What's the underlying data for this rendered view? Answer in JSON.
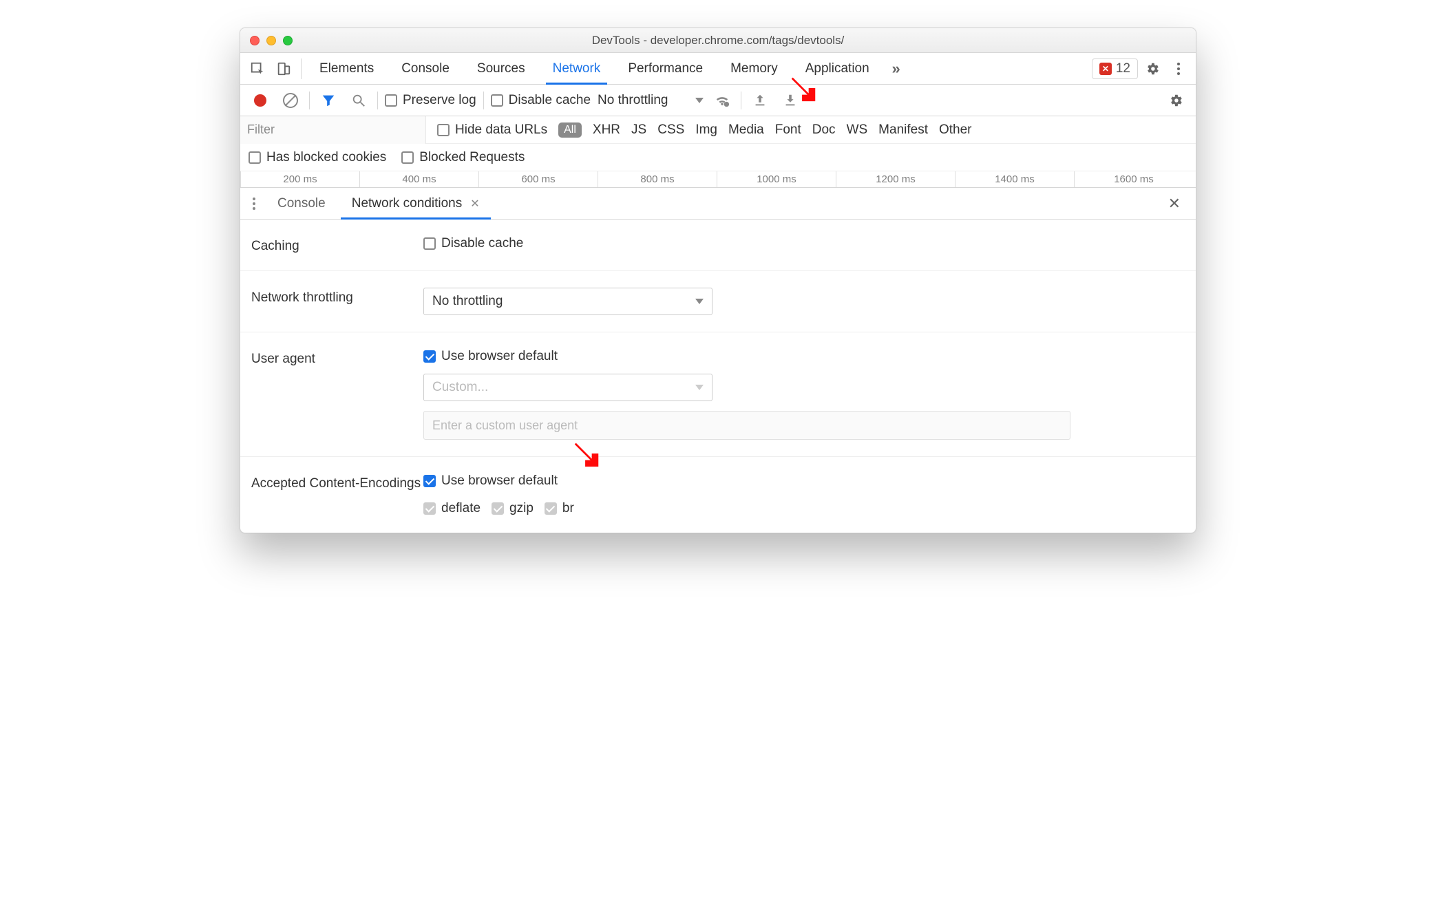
{
  "window": {
    "title": "DevTools - developer.chrome.com/tags/devtools/"
  },
  "tabs": {
    "items": [
      "Elements",
      "Console",
      "Sources",
      "Network",
      "Performance",
      "Memory",
      "Application"
    ],
    "active_index": 3
  },
  "errors": {
    "count": "12"
  },
  "net_toolbar": {
    "preserve_log": "Preserve log",
    "disable_cache": "Disable cache",
    "throttling": "No throttling"
  },
  "filter": {
    "placeholder": "Filter",
    "hide_data_urls": "Hide data URLs",
    "all_label": "All",
    "types": [
      "XHR",
      "JS",
      "CSS",
      "Img",
      "Media",
      "Font",
      "Doc",
      "WS",
      "Manifest",
      "Other"
    ]
  },
  "filter2": {
    "blocked_cookies": "Has blocked cookies",
    "blocked_requests": "Blocked Requests"
  },
  "timeline": {
    "ticks": [
      "200 ms",
      "400 ms",
      "600 ms",
      "800 ms",
      "1000 ms",
      "1200 ms",
      "1400 ms",
      "1600 ms"
    ]
  },
  "drawer_tabs": {
    "console": "Console",
    "net_conditions": "Network conditions"
  },
  "sections": {
    "caching": {
      "label": "Caching",
      "disable_cache": "Disable cache"
    },
    "throttling": {
      "label": "Network throttling",
      "value": "No throttling"
    },
    "user_agent": {
      "label": "User agent",
      "use_default": "Use browser default",
      "custom_select": "Custom...",
      "input_placeholder": "Enter a custom user agent"
    },
    "encodings": {
      "label": "Accepted Content-Encodings",
      "use_default": "Use browser default",
      "items": [
        "deflate",
        "gzip",
        "br"
      ]
    }
  }
}
